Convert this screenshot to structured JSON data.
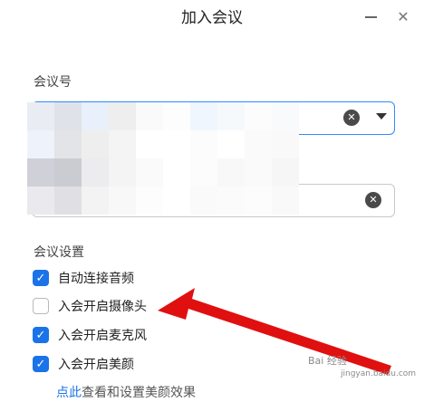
{
  "window": {
    "title": "加入会议",
    "minimize_icon": "minimize-icon",
    "close_icon": "close-icon"
  },
  "meeting_id": {
    "label": "会议号",
    "value": "",
    "clear_icon": "clear-circle-x-icon",
    "dropdown_icon": "caret-down-icon"
  },
  "name_field": {
    "value": "",
    "clear_icon": "clear-circle-x-icon"
  },
  "settings": {
    "label": "会议设置",
    "options": [
      {
        "label": "自动连接音频",
        "checked": true
      },
      {
        "label": "入会开启摄像头",
        "checked": false
      },
      {
        "label": "入会开启麦克风",
        "checked": true
      },
      {
        "label": "入会开启美颜",
        "checked": true
      }
    ],
    "beauty_link": {
      "link_text": "点此",
      "rest_text": "查看和设置美颜效果"
    }
  },
  "watermark": {
    "line1": "Bai 经验",
    "line2": "jingyan.baidu.com"
  },
  "colors": {
    "accent": "#1a73e8",
    "focus_border": "#2d8cff",
    "arrow": "#e01010"
  }
}
